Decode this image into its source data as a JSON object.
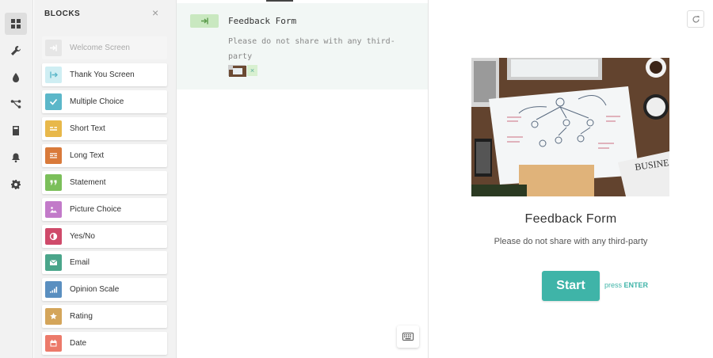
{
  "sidebar": {
    "items": [
      {
        "icon": "grid-icon",
        "active": true
      },
      {
        "icon": "wrench-icon",
        "active": false
      },
      {
        "icon": "droplet-icon",
        "active": false
      },
      {
        "icon": "logic-icon",
        "active": false
      },
      {
        "icon": "calculator-icon",
        "active": false
      },
      {
        "icon": "bell-icon",
        "active": false
      },
      {
        "icon": "gear-icon",
        "active": false
      }
    ]
  },
  "blocks": {
    "title": "BLOCKS",
    "close_symbol": "×",
    "items": [
      {
        "label": "Welcome Screen",
        "color": "#e6e6e6",
        "icon": "enter-icon",
        "disabled": true
      },
      {
        "label": "Thank You Screen",
        "color": "#cfeef3",
        "icon": "exit-icon",
        "disabled": false
      },
      {
        "label": "Multiple Choice",
        "color": "#5bb7c9",
        "icon": "check-icon",
        "disabled": false
      },
      {
        "label": "Short Text",
        "color": "#e8b84a",
        "icon": "short-text-icon",
        "disabled": false
      },
      {
        "label": "Long Text",
        "color": "#d97a3a",
        "icon": "long-text-icon",
        "disabled": false
      },
      {
        "label": "Statement",
        "color": "#7bbf5a",
        "icon": "quote-icon",
        "disabled": false
      },
      {
        "label": "Picture Choice",
        "color": "#c27ac9",
        "icon": "picture-icon",
        "disabled": false
      },
      {
        "label": "Yes/No",
        "color": "#cf4a6a",
        "icon": "yes-no-icon",
        "disabled": false
      },
      {
        "label": "Email",
        "color": "#4aa58a",
        "icon": "email-icon",
        "disabled": false
      },
      {
        "label": "Opinion Scale",
        "color": "#5a8fc0",
        "icon": "scale-icon",
        "disabled": false
      },
      {
        "label": "Rating",
        "color": "#d4a55a",
        "icon": "star-icon",
        "disabled": false
      },
      {
        "label": "Date",
        "color": "#ec7a6a",
        "icon": "calendar-icon",
        "disabled": false
      }
    ]
  },
  "question": {
    "title": "Feedback Form",
    "description": "Please do not share with any third-party",
    "tag_color": "#c9e8c0",
    "thumb_remove": "×"
  },
  "preview": {
    "title": "Feedback Form",
    "description": "Please do not share with any third-party",
    "start_label": "Start",
    "press_prefix": "press",
    "press_key": "ENTER",
    "accent": "#3fb4a8"
  }
}
